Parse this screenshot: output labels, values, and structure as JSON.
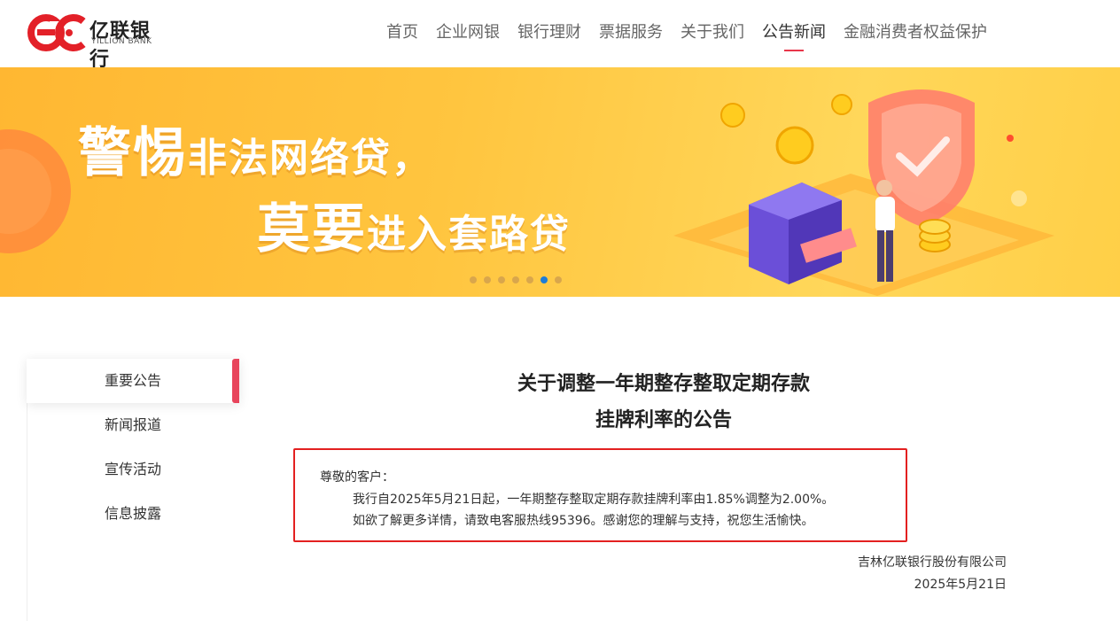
{
  "brand": {
    "name_cn": "亿联银行",
    "name_en": "YILLION BANK",
    "color": "#e32028"
  },
  "nav": {
    "items": [
      "首页",
      "企业网银",
      "银行理财",
      "票据服务",
      "关于我们",
      "公告新闻",
      "金融消费者权益保护"
    ],
    "active": "公告新闻"
  },
  "banner": {
    "line1_big": "警惕",
    "line1_small": "非法网络贷，",
    "line2_big": "莫要",
    "line2_small": "进入套路贷",
    "slide_count": 7,
    "active_slide": 6
  },
  "sidebar": {
    "items": [
      "重要公告",
      "新闻报道",
      "宣传活动",
      "信息披露"
    ],
    "active": "重要公告"
  },
  "article": {
    "title_line1": "关于调整一年期整存整取定期存款",
    "title_line2": "挂牌利率的公告",
    "greeting": "尊敬的客户：",
    "para1": "我行自2025年5月21日起，一年期整存整取定期存款挂牌利率由1.85%调整为2.00%。",
    "para2": "如欲了解更多详情，请致电客服热线95396。感谢您的理解与支持，祝您生活愉快。",
    "signature_org": "吉林亿联银行股份有限公司",
    "signature_date": "2025年5月21日"
  },
  "colors": {
    "accent_red": "#e8364a",
    "highlight_box": "#e32020",
    "banner_yellow": "#ffc53f",
    "active_dot": "#1d7cd8"
  }
}
